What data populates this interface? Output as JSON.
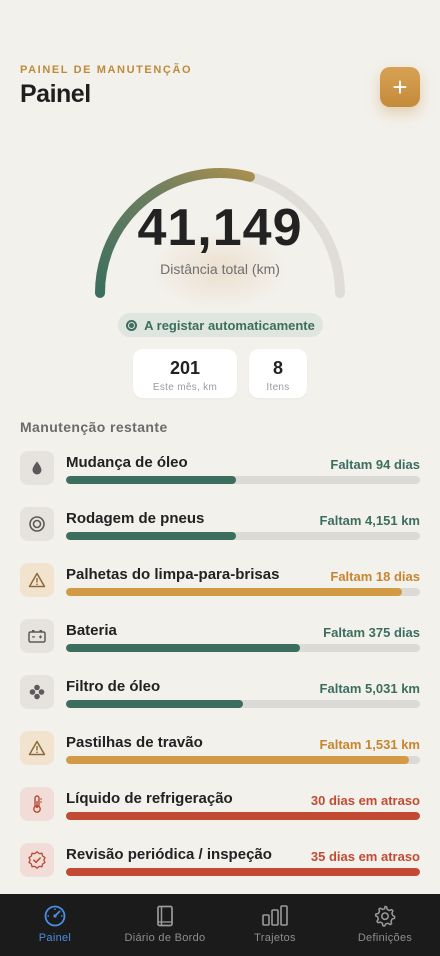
{
  "header": {
    "eyebrow": "PAINEL DE MANUTENÇÃO",
    "title": "Painel",
    "add_icon": "plus-icon"
  },
  "gauge": {
    "value": "41,149",
    "label": "Distância total (km)",
    "progress": 0.58
  },
  "status": {
    "text": "A registar automaticamente"
  },
  "stats": {
    "month": {
      "value": "201",
      "label": "Este mês, km"
    },
    "items": {
      "value": "8",
      "label": "Itens"
    }
  },
  "section": {
    "title": "Manutenção restante"
  },
  "maintenance": [
    {
      "icon": "oil-drop-icon",
      "name": "Mudança de óleo",
      "remaining": "Faltam 94 dias",
      "status": "ok",
      "progress": 0.48
    },
    {
      "icon": "tire-icon",
      "name": "Rodagem de pneus",
      "remaining": "Faltam 4,151 km",
      "status": "ok",
      "progress": 0.48
    },
    {
      "icon": "warning-icon",
      "name": "Palhetas do limpa-para-brisas",
      "remaining": "Faltam 18 dias",
      "status": "warn",
      "progress": 0.95
    },
    {
      "icon": "battery-icon",
      "name": "Bateria",
      "remaining": "Faltam 375 dias",
      "status": "ok",
      "progress": 0.66
    },
    {
      "icon": "filter-icon",
      "name": "Filtro de óleo",
      "remaining": "Faltam 5,031 km",
      "status": "ok",
      "progress": 0.5
    },
    {
      "icon": "warning-icon",
      "name": "Pastilhas de travão",
      "remaining": "Faltam 1,531 km",
      "status": "warn",
      "progress": 0.97
    },
    {
      "icon": "thermometer-icon",
      "name": "Líquido de refrigeração",
      "remaining": "30 dias em atraso",
      "status": "late",
      "progress": 1.0
    },
    {
      "icon": "badge-check-icon",
      "name": "Revisão periódica / inspeção",
      "remaining": "35 dias em atraso",
      "status": "late",
      "progress": 1.0
    }
  ],
  "tabs": [
    {
      "icon": "gauge-icon",
      "label": "Painel",
      "active": true
    },
    {
      "icon": "book-icon",
      "label": "Diário de Bordo",
      "active": false
    },
    {
      "icon": "bar-chart-icon",
      "label": "Trajetos",
      "active": false
    },
    {
      "icon": "gear-icon",
      "label": "Definições",
      "active": false
    }
  ],
  "colors": {
    "accent": "#c48a3a",
    "ok": "#3c6e5f",
    "warn": "#d39a45",
    "late": "#c24a33",
    "tab_active": "#4a8ee6"
  }
}
